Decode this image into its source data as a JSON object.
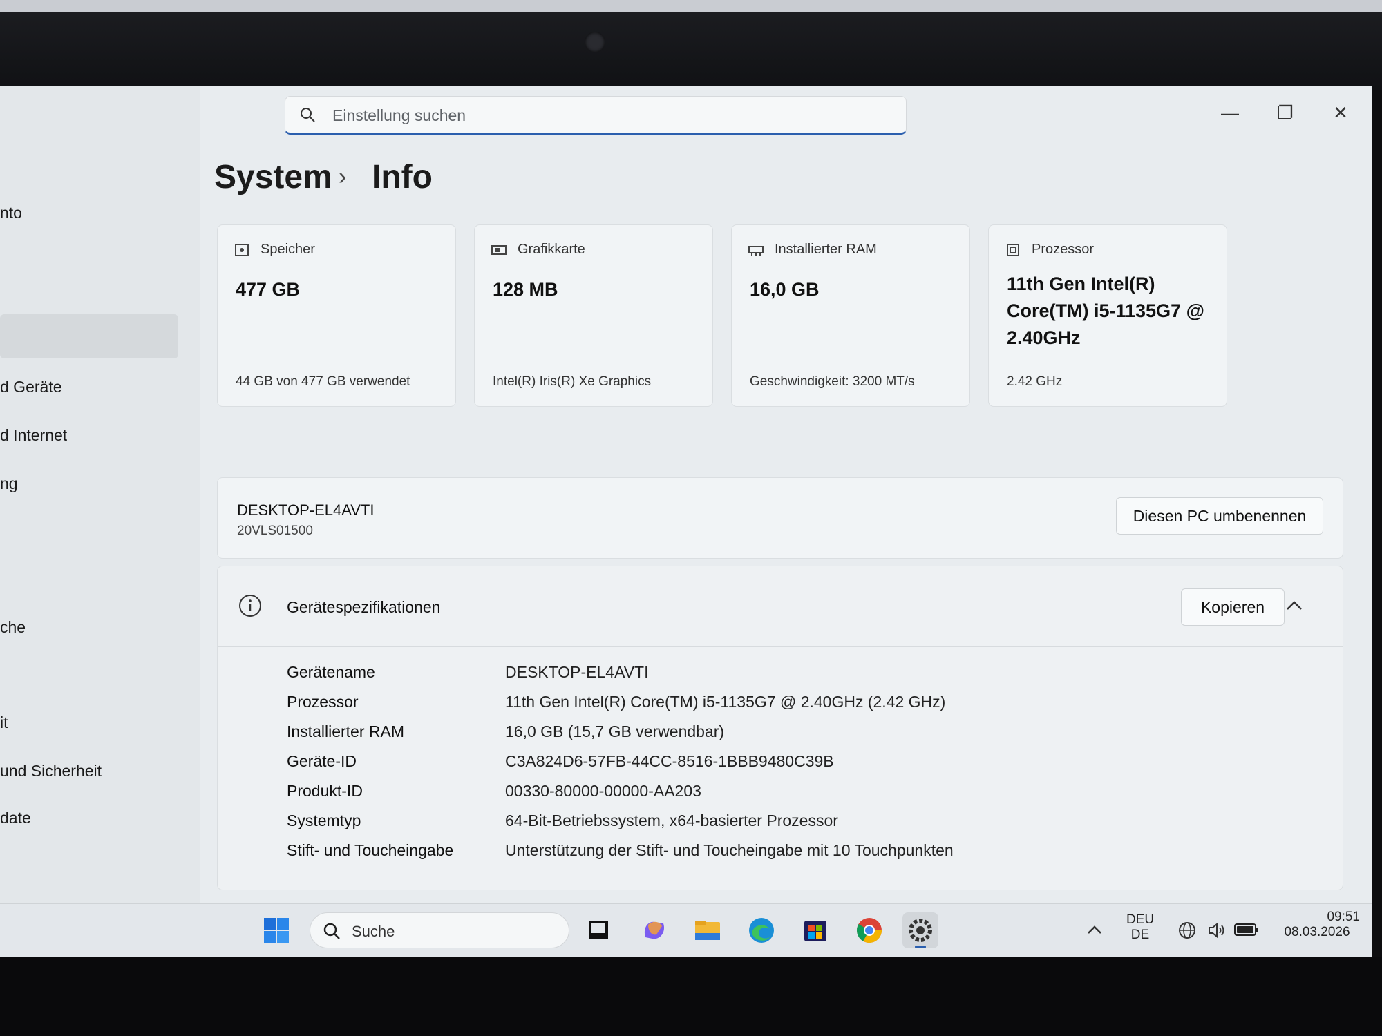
{
  "sidebar": {
    "items": [
      {
        "label": "nto"
      },
      {
        "label": "d Geräte"
      },
      {
        "label": "d Internet"
      },
      {
        "label": "ng"
      },
      {
        "label": "che"
      },
      {
        "label": "it"
      },
      {
        "label": "und Sicherheit"
      },
      {
        "label": "date"
      }
    ]
  },
  "search": {
    "placeholder": "Einstellung suchen"
  },
  "window_controls": {
    "minimize": "—",
    "maximize": "❐",
    "close": "✕"
  },
  "breadcrumb": {
    "parent": "System",
    "separator": "›",
    "current": "Info"
  },
  "cards": [
    {
      "label": "Speicher",
      "value": "477 GB",
      "sub": "44 GB von 477 GB verwendet",
      "icon": "storage-icon"
    },
    {
      "label": "Grafikkarte",
      "value": "128 MB",
      "sub": "Intel(R) Iris(R) Xe Graphics",
      "icon": "gpu-icon"
    },
    {
      "label": "Installierter RAM",
      "value": "16,0 GB",
      "sub": "Geschwindigkeit: 3200 MT/s",
      "icon": "ram-icon"
    },
    {
      "label": "Prozessor",
      "value": "11th Gen Intel(R) Core(TM) i5-1135G7 @ 2.40GHz",
      "sub": "2.42 GHz",
      "icon": "cpu-icon"
    }
  ],
  "pc": {
    "name": "DESKTOP-EL4AVTI",
    "model": "20VLS01500",
    "rename_label": "Diesen PC umbenennen"
  },
  "specs": {
    "title": "Gerätespezifikationen",
    "copy_label": "Kopieren",
    "rows": [
      {
        "key": "Gerätename",
        "value": "DESKTOP-EL4AVTI"
      },
      {
        "key": "Prozessor",
        "value": "11th Gen Intel(R) Core(TM) i5-1135G7 @ 2.40GHz (2.42 GHz)"
      },
      {
        "key": "Installierter RAM",
        "value": "16,0 GB (15,7 GB verwendbar)"
      },
      {
        "key": "Geräte-ID",
        "value": "C3A824D6-57FB-44CC-8516-1BBB9480C39B"
      },
      {
        "key": "Produkt-ID",
        "value": "00330-80000-00000-AA203"
      },
      {
        "key": "Systemtyp",
        "value": "64-Bit-Betriebssystem, x64-basierter Prozessor"
      },
      {
        "key": "Stift- und Toucheingabe",
        "value": "Unterstützung der Stift- und Toucheingabe mit 10 Touchpunkten"
      }
    ]
  },
  "taskbar": {
    "search_label": "Suche",
    "lang_top": "DEU",
    "lang_bottom": "DE",
    "time": "09:51",
    "date": "08.03.2026"
  },
  "colors": {
    "accent": "#2b5fae",
    "background": "#e8ecef",
    "card": "#f1f4f6"
  }
}
